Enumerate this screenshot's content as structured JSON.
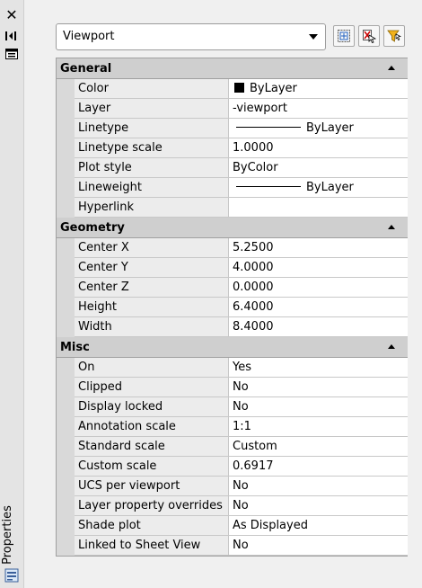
{
  "palette": {
    "title": "Properties",
    "close_icon": "close-icon",
    "autohide_icon": "autohide-icon",
    "properties_menu_icon": "properties-menu-icon"
  },
  "selector": {
    "value": "Viewport",
    "buttons": [
      "toggle-pickadd-icon",
      "select-objects-icon",
      "quick-select-icon"
    ]
  },
  "colors": {
    "header_bg": "#cfcfcf",
    "gutter": "#d9d9d9",
    "name_bg": "#ececec"
  },
  "sections": [
    {
      "title": "General",
      "rows": [
        {
          "name": "Color",
          "value": "ByLayer"
        },
        {
          "name": "Layer",
          "value": "-viewport"
        },
        {
          "name": "Linetype",
          "value": "ByLayer"
        },
        {
          "name": "Linetype scale",
          "value": "1.0000"
        },
        {
          "name": "Plot style",
          "value": "ByColor"
        },
        {
          "name": "Lineweight",
          "value": "ByLayer"
        },
        {
          "name": "Hyperlink",
          "value": ""
        }
      ]
    },
    {
      "title": "Geometry",
      "rows": [
        {
          "name": "Center X",
          "value": "5.2500"
        },
        {
          "name": "Center Y",
          "value": "4.0000"
        },
        {
          "name": "Center Z",
          "value": "0.0000"
        },
        {
          "name": "Height",
          "value": "6.4000"
        },
        {
          "name": "Width",
          "value": "8.4000"
        }
      ]
    },
    {
      "title": "Misc",
      "rows": [
        {
          "name": "On",
          "value": "Yes"
        },
        {
          "name": "Clipped",
          "value": "No"
        },
        {
          "name": "Display locked",
          "value": "No"
        },
        {
          "name": "Annotation scale",
          "value": "1:1"
        },
        {
          "name": "Standard scale",
          "value": "Custom"
        },
        {
          "name": "Custom scale",
          "value": "0.6917"
        },
        {
          "name": "UCS per viewport",
          "value": "No"
        },
        {
          "name": "Layer property overrides",
          "value": "No"
        },
        {
          "name": "Shade plot",
          "value": "As Displayed"
        },
        {
          "name": "Linked to Sheet View",
          "value": "No"
        }
      ]
    }
  ]
}
